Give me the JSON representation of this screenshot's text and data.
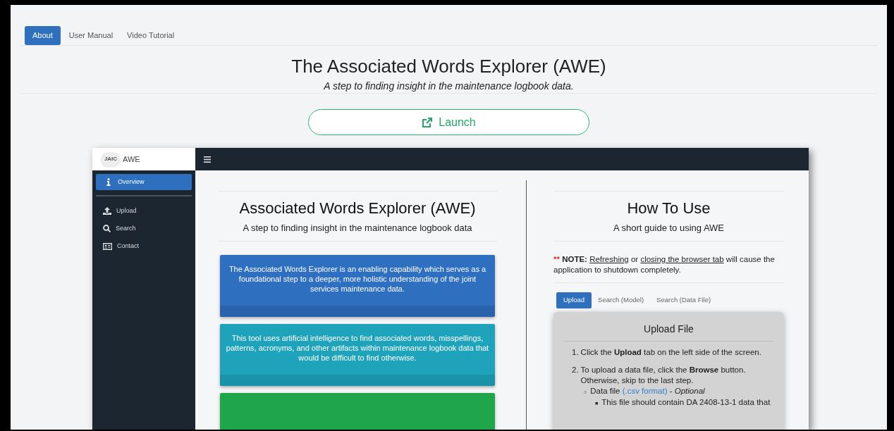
{
  "nav_tabs": [
    {
      "label": "About",
      "selected": true
    },
    {
      "label": "User Manual",
      "selected": false
    },
    {
      "label": "Video Tutorial",
      "selected": false
    }
  ],
  "header": {
    "title": "The Associated Words Explorer (AWE)",
    "subtitle": "A step to finding insight in the maintenance logbook data."
  },
  "launch_button": {
    "label": "Launch"
  },
  "app_preview": {
    "brand": {
      "logo_text": "JAIC",
      "app_name": "AWE"
    },
    "sidebar_items": [
      {
        "label": "Overview",
        "kind": "info",
        "selected": true
      },
      {
        "label": "Upload",
        "kind": "upload",
        "selected": false
      },
      {
        "label": "Search",
        "kind": "search",
        "selected": false
      },
      {
        "label": "Contact",
        "kind": "contact",
        "selected": false
      }
    ],
    "overview": {
      "title": "Associated Words Explorer (AWE)",
      "subtitle": "A step to finding insight in the maintenance logbook data",
      "cards": [
        {
          "text": "The Associated Words Explorer is an enabling capability which serves as a foundational step to a deeper, more holistic understanding of the joint services maintenance data.",
          "color": "#2f6fc0"
        },
        {
          "text": "This tool uses artificial intelligence to find associated words, misspellings, patterns, acronyms, and other artifacts within maintenance logbook data that would be difficult to find otherwise.",
          "color": "#1ea3bb"
        },
        {
          "color": "#1fa54a"
        }
      ]
    },
    "how_to_use": {
      "title": "How To Use",
      "subtitle": "A short guide to using AWE",
      "note": [
        {
          "text": "**",
          "kind": "marker"
        },
        {
          "text": " **NOTE:** "
        },
        {
          "text": "Refreshing",
          "kind": "link"
        },
        {
          "text": " or "
        },
        {
          "text": "closing the browser tab",
          "kind": "link"
        },
        {
          "text": " will cause the application to shutdown completely."
        }
      ],
      "tabs": [
        {
          "label": "Upload",
          "selected": true
        },
        {
          "label": "Search (Model)",
          "selected": false
        },
        {
          "label": "Search (Data File)",
          "selected": false
        }
      ],
      "card": {
        "title": "Upload File",
        "steps": [
          {
            "number": "1.",
            "text": "Click the **Upload** tab on the left side of the screen."
          },
          {
            "number": "2.",
            "text": "To upload a data file, click the **Browse** button. Otherwise, skip to the last step.",
            "children": [
              {
                "bullet": "○",
                "segments": [
                  {
                    "text": "Data file "
                  },
                  {
                    "text": "(.csv format)",
                    "kind": "file-link"
                  },
                  {
                    "text": " - *Optional*"
                  }
                ],
                "children": [
                  {
                    "bullet": "■",
                    "segments": [
                      {
                        "text": "This file should contain DA 2408-13-1 data that"
                      }
                    ]
                  }
                ]
              }
            ]
          }
        ]
      }
    }
  }
}
